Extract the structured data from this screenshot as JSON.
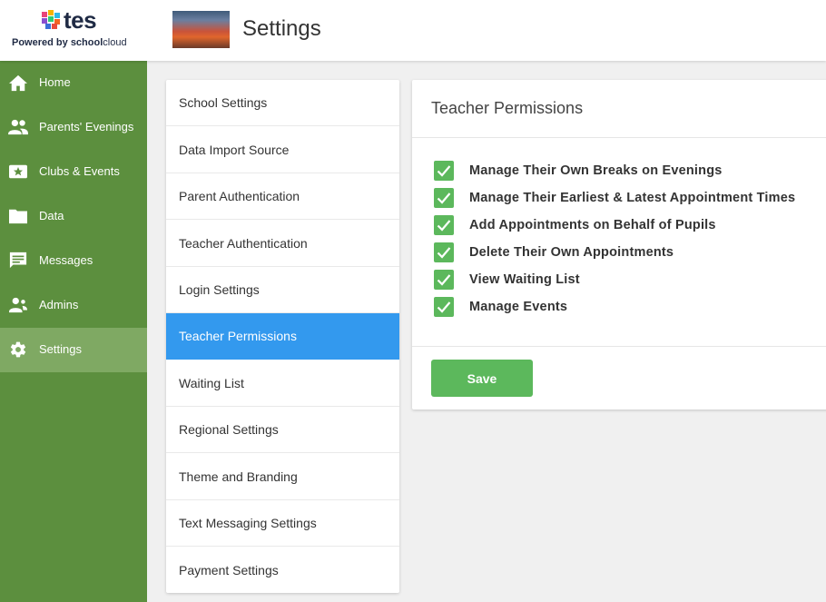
{
  "brand": {
    "logo_text": "tes",
    "powered_by": "Powered by",
    "school_a": "school",
    "school_b": "cloud"
  },
  "header": {
    "title": "Settings"
  },
  "sidebar": {
    "items": [
      {
        "label": "Home",
        "icon": "home-icon"
      },
      {
        "label": "Parents' Evenings",
        "icon": "people-icon"
      },
      {
        "label": "Clubs & Events",
        "icon": "star-card-icon"
      },
      {
        "label": "Data",
        "icon": "folder-icon"
      },
      {
        "label": "Messages",
        "icon": "message-icon"
      },
      {
        "label": "Admins",
        "icon": "admins-icon"
      },
      {
        "label": "Settings",
        "icon": "gear-icon",
        "active": true
      }
    ]
  },
  "settings_menu": {
    "items": [
      "School Settings",
      "Data Import Source",
      "Parent Authentication",
      "Teacher Authentication",
      "Login Settings",
      "Teacher Permissions",
      "Waiting List",
      "Regional Settings",
      "Theme and Branding",
      "Text Messaging Settings",
      "Payment Settings"
    ],
    "active_index": 5
  },
  "panel": {
    "title": "Teacher Permissions",
    "permissions": [
      {
        "label": "Manage Their Own Breaks on Evenings",
        "checked": true
      },
      {
        "label": "Manage Their Earliest & Latest Appointment Times",
        "checked": true
      },
      {
        "label": "Add Appointments on Behalf of Pupils",
        "checked": true
      },
      {
        "label": "Delete Their Own Appointments",
        "checked": true
      },
      {
        "label": "View Waiting List",
        "checked": true
      },
      {
        "label": "Manage Events",
        "checked": true
      }
    ],
    "save_label": "Save"
  },
  "colors": {
    "sidebar_bg": "#5c8f3e",
    "sidebar_active": "#7fa963",
    "menu_active": "#3399ee",
    "accent_green": "#5cb85c"
  }
}
